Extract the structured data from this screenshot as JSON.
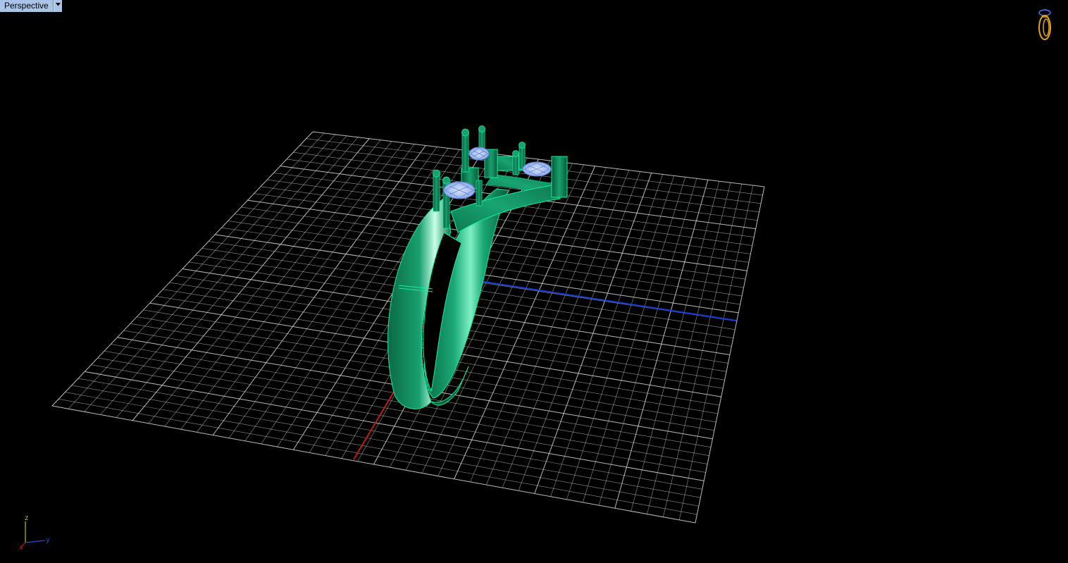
{
  "viewport": {
    "title": "Perspective",
    "menu_icon": "dropdown-arrow-icon"
  },
  "axis_triad": {
    "z_label": "z",
    "y_label": "y",
    "x_label": "x",
    "colors": {
      "x": "#c01a1a",
      "y": "#2a4bd0",
      "z": "#b8b830"
    }
  },
  "scene": {
    "background": "#000000",
    "grid_color": "#cfcfcf",
    "x_axis_color": "#c01a1a",
    "y_axis_color": "#1a3cd8",
    "metal_color": "#0f8a5c",
    "gem_color": "#a9c4f0",
    "object": "ring-model"
  },
  "nav_widget": {
    "icon": "ring-navigation-icon",
    "color": "#e3a21a"
  }
}
